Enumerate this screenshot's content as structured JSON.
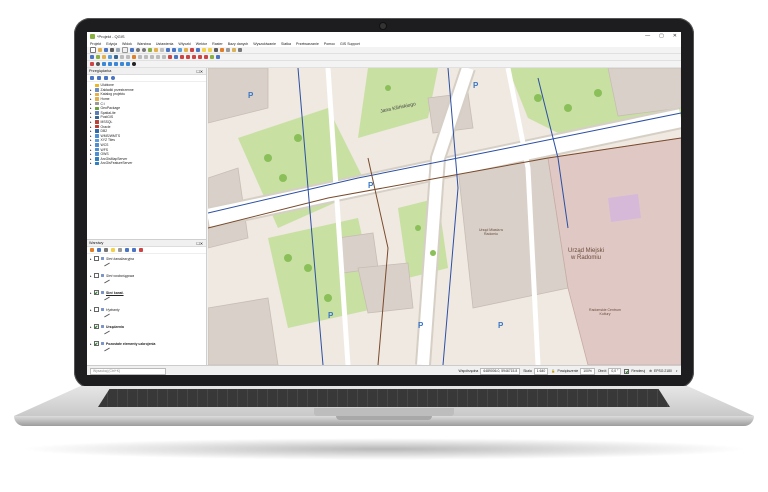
{
  "window": {
    "title": "*Projekt - QGIS",
    "controls": [
      "—",
      "▢",
      "✕"
    ]
  },
  "menubar": [
    "Projekt",
    "Edycja",
    "Widok",
    "Warstwa",
    "Ustawienia",
    "Wtyczki",
    "Wektor",
    "Raster",
    "Bazy danych",
    "Wyszukiwanie",
    "Siatka",
    "Przetwarzanie",
    "Pomoc",
    "GIS Support"
  ],
  "browser_panel": {
    "title": "Przeglądarka",
    "items": [
      {
        "label": "Ulubione",
        "icon": "star-icon",
        "color": "#e8b825"
      },
      {
        "label": "Zakładki przestrzenne",
        "icon": "bookmark-icon",
        "color": "#6b8ec9"
      },
      {
        "label": "Katalog projektu",
        "icon": "folder-icon",
        "color": "#e3b14b"
      },
      {
        "label": "Home",
        "icon": "folder-icon",
        "color": "#e3b14b"
      },
      {
        "label": "C:\\",
        "icon": "drive-icon",
        "color": "#9a9a9a"
      },
      {
        "label": "GeoPackage",
        "icon": "geopackage-icon",
        "color": "#6fa13a"
      },
      {
        "label": "SpatiaLite",
        "icon": "spatialite-icon",
        "color": "#5a7fb8"
      },
      {
        "label": "PostGIS",
        "icon": "elephant-icon",
        "color": "#336791"
      },
      {
        "label": "MSSQL",
        "icon": "db-icon",
        "color": "#b5443a"
      },
      {
        "label": "Oracle",
        "icon": "db-icon",
        "color": "#c43c2c"
      },
      {
        "label": "DB2",
        "icon": "db-icon",
        "color": "#2f6aa8"
      },
      {
        "label": "WMS/WMTS",
        "icon": "globe-icon",
        "color": "#4d8fd1"
      },
      {
        "label": "XYZ Tiles",
        "icon": "grid-icon",
        "color": "#5b9bd5"
      },
      {
        "label": "WCS",
        "icon": "globe-icon",
        "color": "#4d8fd1"
      },
      {
        "label": "WFS",
        "icon": "globe-icon",
        "color": "#4d8fd1"
      },
      {
        "label": "OWS",
        "icon": "globe-icon",
        "color": "#4d8fd1"
      },
      {
        "label": "ArcGisMapServer",
        "icon": "arcgis-icon",
        "color": "#2f7fc1"
      },
      {
        "label": "ArcGisFeatureServer",
        "icon": "arcgis-icon",
        "color": "#2f7fc1"
      }
    ]
  },
  "layers_panel": {
    "title": "Warstwy",
    "layers": [
      {
        "label": "Sieć kanalizacyjna",
        "checked": false,
        "italic": true,
        "bold": false
      },
      {
        "label": "Sieć wodociągowa",
        "checked": false,
        "italic": true,
        "bold": false
      },
      {
        "label": "Sieć kanał.",
        "checked": true,
        "italic": false,
        "bold": true,
        "underline": true
      },
      {
        "label": "Hydranty",
        "checked": false,
        "italic": true,
        "bold": false
      },
      {
        "label": "Urządzenia",
        "checked": true,
        "italic": false,
        "bold": true
      },
      {
        "label": "Pozostałe elementy uzbrojenia",
        "checked": true,
        "italic": false,
        "bold": true
      }
    ]
  },
  "search": {
    "placeholder": "Wyszukaj (Ctrl+K)"
  },
  "statusbar": {
    "coord_label": "Współrzędna",
    "coord_value": "6489006.0, 5946715.8",
    "scale_label": "Skala",
    "scale_value": "1:640",
    "magnifier_label": "Powiększenie",
    "magnifier_value": "100%",
    "rotation_label": "Obrót",
    "rotation_value": "0,0 °",
    "render_label": "Renderuj",
    "crs": "EPSG:2180"
  },
  "map": {
    "street_label": "Jana Kilińskiego",
    "building_label_1": "Urząd Miejski",
    "building_label_2": "w Radomiu",
    "poi_label_1": "Urząd Miasta w Radomiu",
    "poi_label_2": "Radomskie Centrum Kultury",
    "colors": {
      "background": "#efe9e1",
      "grass": "#c8e0a2",
      "building": "#d9d0c9",
      "road": "#ffffff",
      "road_outline": "#d6cfc6",
      "townhall": "#e0c9c4",
      "pipe_blue": "#2c4fa3",
      "pipe_brown": "#7a4a2b"
    }
  }
}
